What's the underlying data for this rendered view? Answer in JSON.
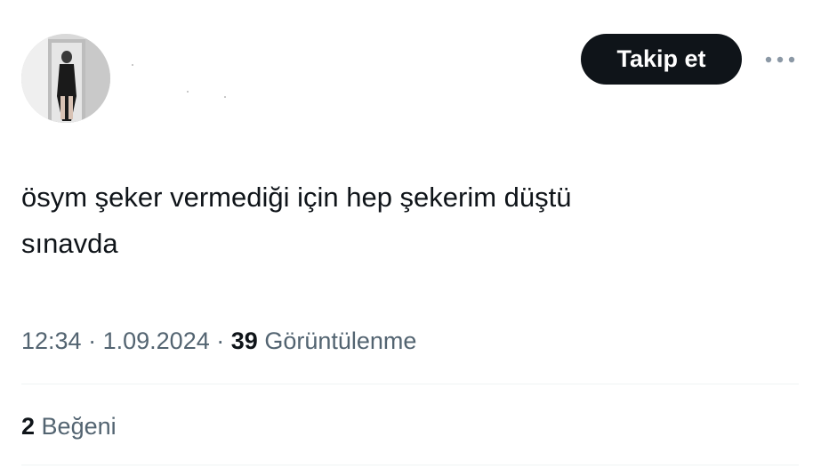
{
  "author": {
    "avatar": "profile-photo"
  },
  "header": {
    "follow_label": "Takip et",
    "more_icon": "more-horizontal-icon"
  },
  "tweet": {
    "text_line1": "ösym şeker vermediği için hep şekerim düştü",
    "text_line2": "sınavda"
  },
  "meta": {
    "time": "12:34",
    "separator": "·",
    "date": "1.09.2024",
    "views_count": "39",
    "views_label": "Görüntülenme"
  },
  "stats": {
    "likes_count": "2",
    "likes_label": "Beğeni"
  },
  "colors": {
    "text_primary": "#0f1419",
    "text_secondary": "#536471",
    "button_bg": "#0f1419",
    "divider": "#eff3f4"
  }
}
